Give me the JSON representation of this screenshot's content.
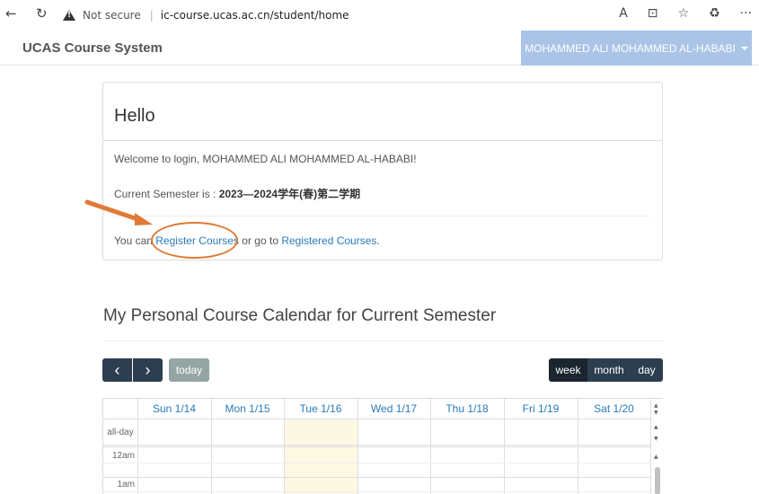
{
  "browser": {
    "back_icon": "←",
    "refresh_icon": "↻",
    "security_label": "Not secure",
    "separator": "|",
    "url": "ic-course.ucas.ac.cn/student/home",
    "read_aloud_icon": "A",
    "split_icon": "⊡",
    "favorites_icon": "☆",
    "extensions_icon": "♻",
    "more_icon": "···"
  },
  "navbar": {
    "brand": "UCAS Course System",
    "user_name": "MOHAMMED ALI MOHAMMED AL-HABABI",
    "user_menu_color": "#a9c4e6"
  },
  "panel": {
    "title": "Hello",
    "welcome": "Welcome to login, MOHAMMED ALI MOHAMMED AL-HABABI!",
    "semester_prefix": "Current Semester is : ",
    "semester_value": "2023—2024学年(春)第二学期",
    "action_prefix": "You can ",
    "register_link": "Register Courses",
    "action_middle": " or go to ",
    "registered_link": "Registered Courses",
    "action_suffix": "."
  },
  "calendar": {
    "title": "My Personal Course Calendar for Current Semester",
    "prev_icon": "‹",
    "next_icon": "›",
    "today_label": "today",
    "views": [
      "week",
      "month",
      "day"
    ],
    "active_view": "week",
    "days": [
      "Sun 1/14",
      "Mon 1/15",
      "Tue 1/16",
      "Wed 1/17",
      "Thu 1/18",
      "Fri 1/19",
      "Sat 1/20"
    ],
    "today_index": 2,
    "allday_label": "all-day",
    "time_slots": [
      "12am",
      "1am"
    ],
    "link_color": "#2a7ab8",
    "today_color": "#fcf8e3"
  }
}
